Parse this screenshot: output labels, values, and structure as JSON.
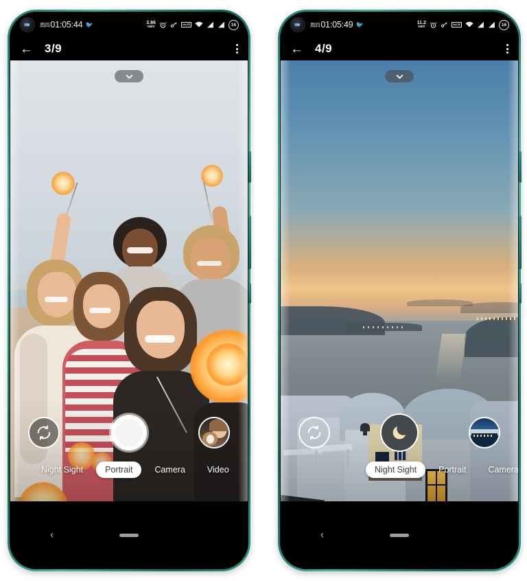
{
  "scene": {
    "background": "#ffffff",
    "frame_color": "#2e9886",
    "device_count": 2
  },
  "phones": [
    {
      "id": "phone-left",
      "status_bar": {
        "day": "周四",
        "time": "01:05:44",
        "emoji": "🐦",
        "net_speed_value": "3.86",
        "net_speed_unit": "KB/S",
        "icons": [
          "alarm-icon",
          "vpn-key-icon",
          "volte-icon",
          "wifi-icon",
          "signal-icon",
          "signal-icon"
        ],
        "volte_label": "VoLTE",
        "battery_level": "16"
      },
      "app_bar": {
        "back_label": "←",
        "counter": "3/9",
        "overflow_label": "⋮"
      },
      "viewfinder": {
        "scene_name": "group-selfie-sparklers",
        "collapse_label": "⌄"
      },
      "controls": {
        "flip_label": "switch-camera",
        "shutter_label": "capture",
        "thumbnail_label": "last-photo"
      },
      "modes": [
        {
          "label": "Night Sight",
          "selected": false
        },
        {
          "label": "Portrait",
          "selected": true
        },
        {
          "label": "Camera",
          "selected": false
        },
        {
          "label": "Video",
          "selected": false
        }
      ],
      "nav_bar": {
        "back_label": "‹",
        "home_label": "home-pill"
      }
    },
    {
      "id": "phone-right",
      "status_bar": {
        "day": "周四",
        "time": "01:05:49",
        "emoji": "🐦",
        "net_speed_value": "11.2",
        "net_speed_unit": "KB/S",
        "icons": [
          "alarm-icon",
          "vpn-key-icon",
          "volte-icon",
          "wifi-icon",
          "signal-icon",
          "signal-icon"
        ],
        "volte_label": "VoLTE",
        "battery_level": "16"
      },
      "app_bar": {
        "back_label": "←",
        "counter": "4/9",
        "overflow_label": "⋮"
      },
      "viewfinder": {
        "scene_name": "santorini-sunset-night",
        "collapse_label": "⌄"
      },
      "controls": {
        "flip_label": "switch-camera",
        "shutter_label": "capture-night",
        "thumbnail_label": "last-photo"
      },
      "modes": [
        {
          "label": "Night Sight",
          "selected": true
        },
        {
          "label": "Portrait",
          "selected": false
        },
        {
          "label": "Camera",
          "selected": false
        }
      ],
      "nav_bar": {
        "back_label": "‹",
        "home_label": "home-pill"
      }
    }
  ]
}
